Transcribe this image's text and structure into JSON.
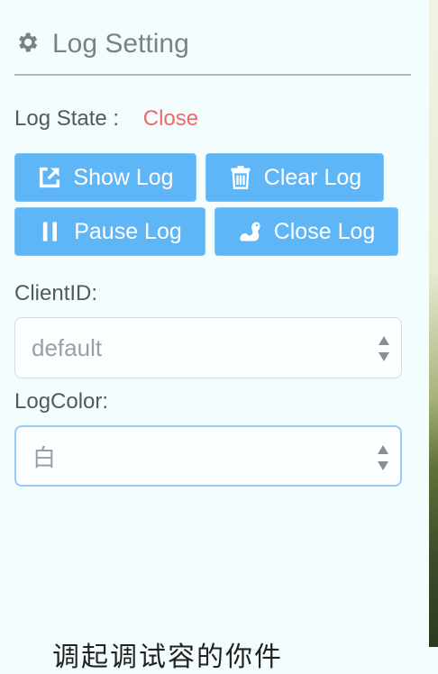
{
  "panel": {
    "title": "Log Setting",
    "log_state": {
      "label": "Log State :",
      "value": "Close"
    },
    "buttons": {
      "show_log": "Show Log",
      "clear_log": "Clear Log",
      "pause_log": "Pause Log",
      "close_log": "Close Log"
    },
    "client_id": {
      "label": "ClientID:",
      "value": "default"
    },
    "log_color": {
      "label": "LogColor:",
      "value": "白"
    }
  },
  "footer": {
    "text": "调起调试容的你件"
  }
}
